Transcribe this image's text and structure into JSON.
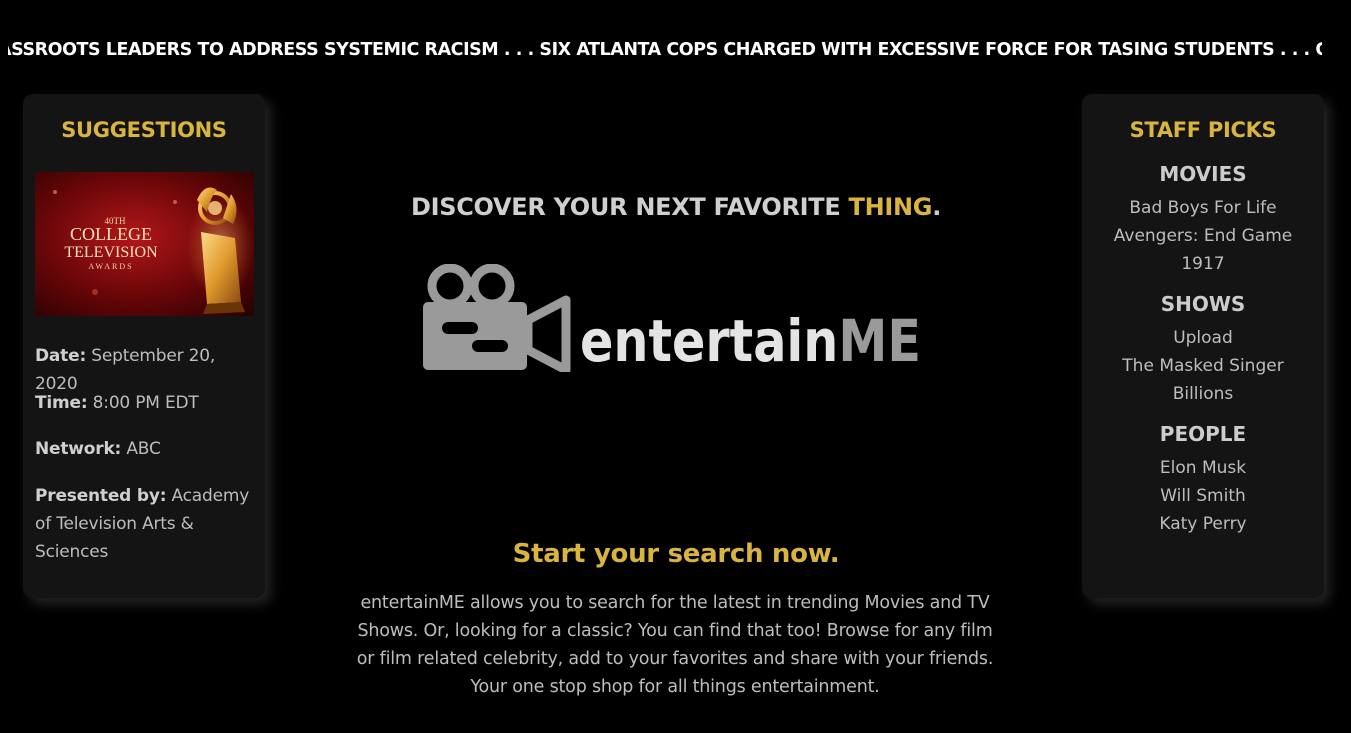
{
  "ticker": {
    "text": "ASSROOTS LEADERS TO ADDRESS SYSTEMIC RACISM . . . SIX ATLANTA COPS CHARGED WITH EXCESSIVE FORCE FOR TASING STUDENTS . . . GE"
  },
  "suggestions": {
    "title": "SUGGESTIONS",
    "image": {
      "line1": "40TH",
      "line2": "COLLEGE",
      "line3": "TELEVISION",
      "line4": "AWARDS"
    },
    "date_label": "Date:",
    "date_value": " September 20, 2020",
    "time_label": "Time:",
    "time_value": " 8:00 PM EDT",
    "network_label": "Network:",
    "network_value": " ABC",
    "presented_label": "Presented by:",
    "presented_value": " Academy of Television Arts & Sciences"
  },
  "main": {
    "tagline_prefix": "DISCOVER YOUR NEXT FAVORITE ",
    "tagline_accent": "THING",
    "tagline_suffix": ".",
    "logo_text_light": "entertain",
    "logo_text_bold": "ME",
    "search_title": "Start your search now.",
    "blurb": "entertainME allows you to search for the latest in trending Movies and TV Shows. Or, looking for a classic? You can find that too! Browse for any film or film related celebrity, add to your favorites and share with your friends. Your one stop shop for all things entertainment."
  },
  "staff_picks": {
    "title": "STAFF PICKS",
    "movies_head": "MOVIES",
    "movies": [
      "Bad Boys For Life",
      "Avengers: End Game",
      "1917"
    ],
    "shows_head": "SHOWS",
    "shows": [
      "Upload",
      "The Masked Singer",
      "Billions"
    ],
    "people_head": "PEOPLE",
    "people": [
      "Elon Musk",
      "Will Smith",
      "Katy Perry"
    ]
  },
  "colors": {
    "background": "#000000",
    "panel": "#141414",
    "accent": "#d9b43f",
    "text": "#bdbdbd"
  }
}
